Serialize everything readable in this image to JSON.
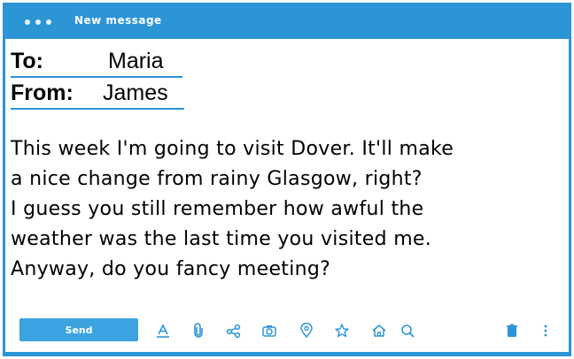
{
  "window": {
    "title": "New message"
  },
  "header": {
    "to_label": "To:",
    "to_value": "Maria",
    "from_label": "From:",
    "from_value": "James"
  },
  "message": {
    "lines": [
      "This week I'm going to visit Dover. It'll make",
      "a nice change from rainy Glasgow, right?",
      "I guess you still remember how awful the",
      "weather was the last time you visited me.",
      "Anyway, do you fancy meeting?"
    ]
  },
  "toolbar": {
    "send_label": "Send",
    "icons": [
      "format-text-icon",
      "attach-icon",
      "share-icon",
      "camera-icon",
      "location-icon",
      "star-icon",
      "home-icon",
      "search-icon",
      "trash-icon",
      "more-icon"
    ]
  },
  "colors": {
    "accent": "#2b95d6",
    "send_button": "#3aa3e0"
  }
}
